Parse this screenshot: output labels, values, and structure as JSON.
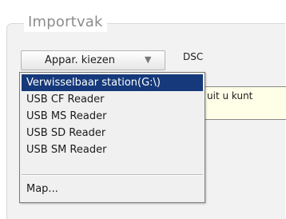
{
  "group": {
    "title": "Importvak"
  },
  "source_selector": {
    "label": "Appar. kiezen",
    "arrow_icon": "chevron-down-icon"
  },
  "device_label": "DSC",
  "tooltip": {
    "text": "uit u kunt"
  },
  "dropdown": {
    "items": [
      {
        "label": "Verwisselbaar station(G:\\)",
        "selected": true
      },
      {
        "label": "USB CF Reader",
        "selected": false
      },
      {
        "label": "USB MS Reader",
        "selected": false
      },
      {
        "label": "USB SD Reader",
        "selected": false
      },
      {
        "label": "USB SM Reader",
        "selected": false
      },
      {
        "label": "Map...",
        "selected": false
      }
    ]
  },
  "colors": {
    "selection": "#15397a",
    "menu_background": "#f0f0f0",
    "tooltip_background": "#ffffe8",
    "title": "#8c8c8c"
  }
}
